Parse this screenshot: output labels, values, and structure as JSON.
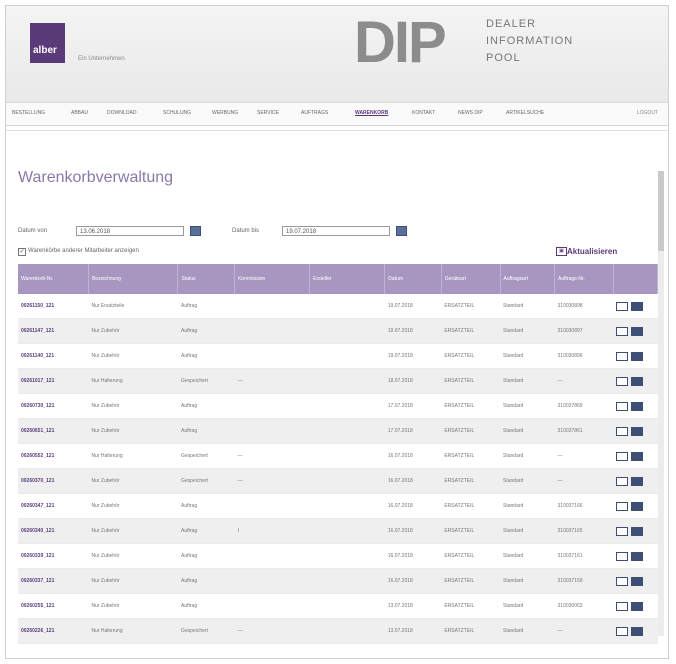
{
  "header": {
    "logo": "alber",
    "logo_sub": "Ein Unternehmen",
    "dip": "DIP",
    "dip_lines": [
      "DEALER",
      "INFORMATION",
      "POOL"
    ]
  },
  "nav": {
    "items": [
      "BESTELLUNG",
      "ABBAU",
      "DOWNLOAD",
      "SCHULUNG",
      "WERBUNG",
      "SERVICE",
      "AUFTRAGS",
      "WARENKORB",
      "KONTAKT",
      "NEWS DIP",
      "ARTIKELSUCHE"
    ],
    "active": "WARENKORB",
    "logout": "LOGOUT"
  },
  "page": {
    "title": "Warenkorbverwaltung",
    "datum_von_label": "Datum von",
    "datum_von_value": "13.06.2018",
    "datum_bis_label": "Datum bis",
    "datum_bis_value": "19.07.2018",
    "checkbox_label": "Warenkörbe anderer Mitarbeiter anzeigen",
    "refresh_label": "Aktualisieren"
  },
  "table": {
    "columns": [
      "Warenkorb-Nr.",
      "Bezeichnung",
      "Status",
      "Kommission",
      "Ersteller",
      "Datum",
      "Geräteart",
      "Auftragsart",
      "Auftrags-Nr."
    ],
    "rows": [
      [
        "00261150_121",
        "Nur Ersatzteile",
        "Auftrag",
        "",
        "",
        "19.07.2018",
        "ERSATZTEIL",
        "Standard",
        "310030898"
      ],
      [
        "00261147_121",
        "Nur Zubehör",
        "Auftrag",
        "",
        "",
        "19.07.2018",
        "ERSATZTEIL",
        "Standard",
        "310030897"
      ],
      [
        "00261140_121",
        "Nur Zubehör",
        "Auftrag",
        "",
        "",
        "19.07.2018",
        "ERSATZTEIL",
        "Standard",
        "310030896"
      ],
      [
        "00261017_121",
        "Nur Halterung",
        "Gespeichert",
        "—",
        "",
        "18.07.2018",
        "ERSATZTEIL",
        "Standard",
        "—"
      ],
      [
        "00260730_121",
        "Nur Zubehör",
        "Auftrag",
        "",
        "",
        "17.07.2018",
        "ERSATZTEIL",
        "Standard",
        "310037869"
      ],
      [
        "00260651_121",
        "Nur Zubehör",
        "Auftrag",
        "",
        "",
        "17.07.2018",
        "ERSATZTEIL",
        "Standard",
        "310037861"
      ],
      [
        "00260552_121",
        "Nur Halterung",
        "Gespeichert",
        "—",
        "",
        "16.07.2018",
        "ERSATZTEIL",
        "Standard",
        "—"
      ],
      [
        "00260370_121",
        "Nur Zubehör",
        "Gespeichert",
        "—",
        "",
        "16.07.2018",
        "ERSATZTEIL",
        "Standard",
        "—"
      ],
      [
        "00260347_121",
        "Nur Zubehör",
        "Auftrag",
        "",
        "",
        "16.07.2018",
        "ERSATZTEIL",
        "Standard",
        "310037166"
      ],
      [
        "00260340_121",
        "Nur Zubehör",
        "Auftrag",
        "I",
        "",
        "16.07.2018",
        "ERSATZTEIL",
        "Standard",
        "310037165"
      ],
      [
        "00260339_121",
        "Nur Zubehör",
        "Auftrag",
        "",
        "",
        "16.07.2018",
        "ERSATZTEIL",
        "Standard",
        "310037161"
      ],
      [
        "00260337_121",
        "Nur Zubehör",
        "Auftrag",
        "",
        "",
        "16.07.2018",
        "ERSATZTEIL",
        "Standard",
        "310037159"
      ],
      [
        "00260255_121",
        "Nur Zubehör",
        "Auftrag",
        "",
        "",
        "13.07.2018",
        "ERSATZTEIL",
        "Standard",
        "310030063"
      ],
      [
        "00260226_121",
        "Nur Halterung",
        "Gespeichert",
        "—",
        "",
        "13.07.2018",
        "ERSATZTEIL",
        "Standard",
        "—"
      ]
    ]
  },
  "colors": {
    "accent": "#5b3a7a",
    "header_row": "#a797c0"
  }
}
